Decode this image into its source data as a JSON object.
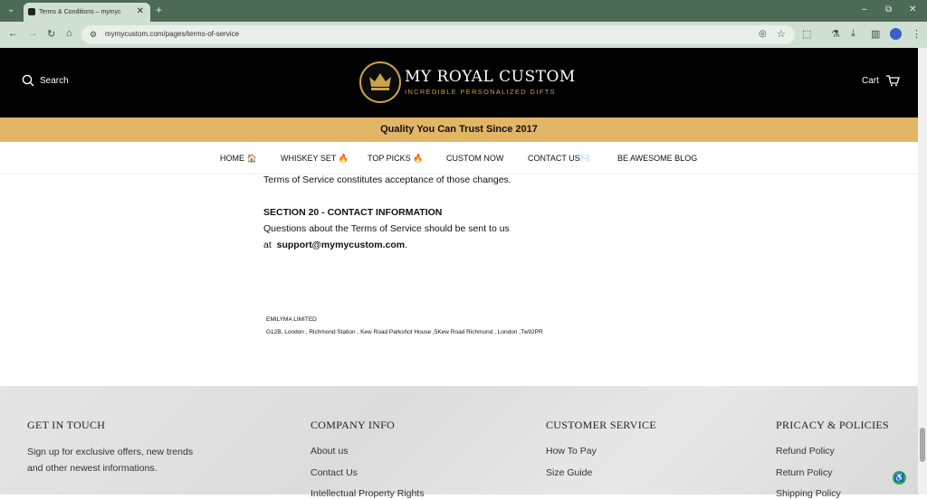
{
  "browser": {
    "tab_title": "Terms & Conditions – mymyc",
    "tab_close": "✕",
    "new_tab": "+",
    "tab_list": "⌄",
    "url": "mymycustom.com/pages/terms-of-service",
    "window_controls": [
      "–",
      "⧉",
      "✕"
    ]
  },
  "header": {
    "search_label": "Search",
    "cart_label": "Cart",
    "logo_title": "MY ROYAL CUSTOM",
    "logo_subtitle": "INCREDIBLE PERSONALIZED GIFTS",
    "logo_badge_text": "CROWN"
  },
  "banner": {
    "text": "Quality You Can Trust Since 2017"
  },
  "nav": {
    "items": [
      {
        "label": "HOME",
        "emoji": "🏠"
      },
      {
        "label": "WHISKEY SET",
        "emoji": "🔥"
      },
      {
        "label": "TOP PICKS",
        "emoji": "🔥"
      },
      {
        "label": "CUSTOM NOW",
        "emoji": ""
      },
      {
        "label": "CONTACT US",
        "emoji": "✉️"
      },
      {
        "label": "BE AWESOME BLOG",
        "emoji": ""
      }
    ]
  },
  "content": {
    "prev_line": "Terms of Service constitutes acceptance of those changes.",
    "section_title": "SECTION 20 - CONTACT INFORMATION",
    "contact_line": "Questions about the Terms of Service should be sent to us",
    "at_label": "at",
    "email": "support@mymycustom.com",
    "email_suffix": ".",
    "company_name": "EMILYMA LIMITED",
    "company_address": "G12B, London , Richmond Station , Kew Road Parkshot House ,5Kew Road Richmond , London ,Tw92PR"
  },
  "footer": {
    "get_in_touch": {
      "title": "GET IN TOUCH",
      "text": "Sign up for exclusive offers, new trends and other newest informations."
    },
    "company_info": {
      "title": "COMPANY INFO",
      "links": [
        "About us",
        "Contact Us",
        "Intellectual Property Rights"
      ]
    },
    "customer_service": {
      "title": "CUSTOMER SERVICE",
      "links": [
        "How To Pay",
        "Size Guide"
      ]
    },
    "privacy": {
      "title": "PRICACY & POLICIES",
      "links": [
        "Refund Policy",
        "Return Policy",
        "Shipping Policy"
      ]
    }
  },
  "colors": {
    "banner": "#e3b567",
    "header": "#000000",
    "browser_tabbar": "#4d6a57",
    "gold": "#c9a24a"
  }
}
